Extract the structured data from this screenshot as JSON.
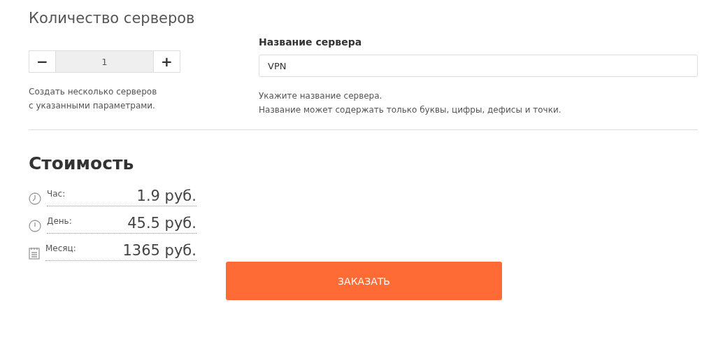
{
  "servers": {
    "title": "Количество серверов",
    "minus": "−",
    "count": "1",
    "plus": "+",
    "hint_lines": [
      "Создать несколько серверов",
      "с указанными параметрами."
    ]
  },
  "name": {
    "label": "Название сервера",
    "value": "VPN",
    "hint_lines": [
      "Укажите название сервера.",
      "Название может содержать только буквы, цифры, дефисы и точки."
    ]
  },
  "cost": {
    "title": "Стоимость",
    "rows": [
      {
        "kind": "hour",
        "label": "Час:",
        "value": "1.9 руб."
      },
      {
        "kind": "day",
        "label": "День:",
        "value": "45.5 руб."
      },
      {
        "kind": "month",
        "label": "Месяц:",
        "value": "1365 руб."
      }
    ]
  },
  "order_button": "ЗАКАЗАТЬ"
}
